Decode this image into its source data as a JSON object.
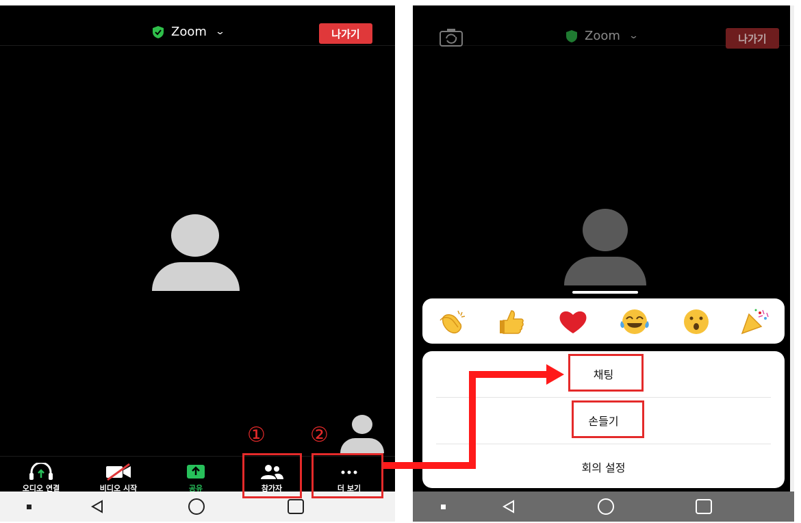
{
  "left_phone": {
    "title": "Zoom",
    "leave_label": "나가기",
    "toolbar": [
      {
        "label": "오디오 연결",
        "icon": "headphones-icon"
      },
      {
        "label": "비디오 시작",
        "icon": "video-off-icon"
      },
      {
        "label": "공유",
        "icon": "share-icon"
      },
      {
        "label": "참가자",
        "icon": "participants-icon"
      },
      {
        "label": "더 보기",
        "icon": "more-icon"
      }
    ],
    "annotations": [
      "①",
      "②"
    ]
  },
  "right_phone": {
    "title": "Zoom",
    "leave_label": "나가기",
    "reactions": [
      "clapping-hands",
      "thumbs-up",
      "heart",
      "tears-of-joy",
      "open-mouth",
      "party-popper"
    ],
    "menu": [
      "채팅",
      "손들기",
      "회의 설정"
    ]
  },
  "colors": {
    "leave_red": "#e0383a",
    "annotation_red": "#e42a2a",
    "zoom_shield_green": "#2fbf4a",
    "share_green": "#27c05a"
  }
}
